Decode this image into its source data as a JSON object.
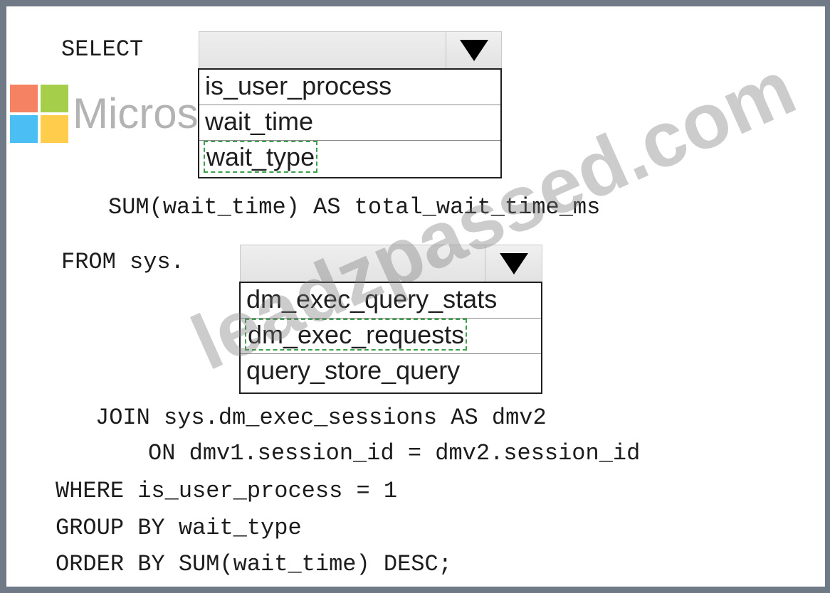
{
  "query": {
    "select_keyword": "SELECT",
    "sum_line": "SUM(wait_time) AS total_wait_time_ms",
    "from_keyword": "FROM sys.",
    "join_line": "JOIN sys.dm_exec_sessions AS dmv2",
    "on_line": "ON dmv1.session_id = dmv2.session_id",
    "where_line": "WHERE is_user_process = 1",
    "group_line": "GROUP BY wait_type",
    "order_line": "ORDER BY SUM(wait_time) DESC;"
  },
  "select_dropdown": {
    "selected_value": "",
    "icon": "triangle-down-icon",
    "options": [
      "is_user_process",
      "wait_time",
      "wait_type"
    ],
    "highlighted": "wait_type"
  },
  "from_dropdown": {
    "selected_value": "",
    "icon": "triangle-down-icon",
    "options": [
      "dm_exec_query_stats",
      "dm_exec_requests",
      "query_store_query"
    ],
    "highlighted": "dm_exec_requests"
  },
  "watermarks": {
    "brand_text": "Microsoft",
    "site_text": "leadzpassed.com",
    "logo_colors": [
      "#f25022",
      "#7fba00",
      "#00a4ef",
      "#ffb900"
    ]
  }
}
